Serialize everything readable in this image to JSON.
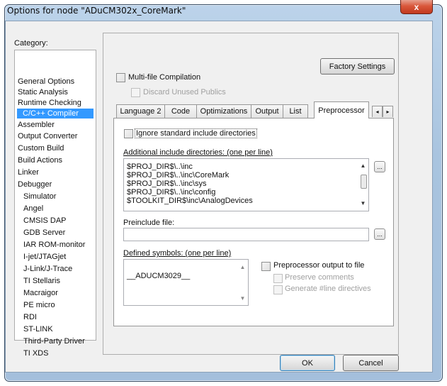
{
  "window": {
    "title": "Options for node \"ADuCM302x_CoreMark\"",
    "close_glyph": "x"
  },
  "category": {
    "label": "Category:",
    "items": [
      "General Options",
      "Static Analysis",
      "Runtime Checking",
      "C/C++ Compiler",
      "Assembler",
      "Output Converter",
      "Custom Build",
      "Build Actions",
      "Linker",
      "Debugger",
      "Simulator",
      "Angel",
      "CMSIS DAP",
      "GDB Server",
      "IAR ROM-monitor",
      "I-jet/JTAGjet",
      "J-Link/J-Trace",
      "TI Stellaris",
      "Macraigor",
      "PE micro",
      "RDI",
      "ST-LINK",
      "Third-Party Driver",
      "TI XDS"
    ],
    "selected": "C/C++ Compiler"
  },
  "panel": {
    "factory_settings": "Factory Settings",
    "multi_file": "Multi-file Compilation",
    "discard_unused": "Discard Unused Publics"
  },
  "tabs": {
    "items": [
      "Language 2",
      "Code",
      "Optimizations",
      "Output",
      "List",
      "Preprocessor"
    ],
    "active": "Preprocessor",
    "scroll_left": "◂",
    "scroll_right": "▸"
  },
  "preprocessor": {
    "ignore_std": "Ignore standard include directories",
    "include_label": "Additional include directories: (one per line)",
    "include_dirs": [
      "$PROJ_DIR$\\..\\inc",
      "$PROJ_DIR$\\..\\inc\\CoreMark",
      "$PROJ_DIR$\\..\\inc\\sys",
      "$PROJ_DIR$\\..\\inc\\config",
      "$TOOLKIT_DIR$\\inc\\AnalogDevices"
    ],
    "preinclude_label": "Preinclude file:",
    "preinclude_value": "",
    "defined_label": "Defined symbols: (one per line)",
    "defined_symbols": [
      "__ADUCM3029__"
    ],
    "pp_output": "Preprocessor output to file",
    "preserve_comments": "Preserve comments",
    "generate_line": "Generate #line directives",
    "browse_glyph": "..."
  },
  "footer": {
    "ok": "OK",
    "cancel": "Cancel"
  },
  "colors": {
    "selection": "#3399ff",
    "frame": "#a9c4df",
    "close": "#d9573b"
  }
}
